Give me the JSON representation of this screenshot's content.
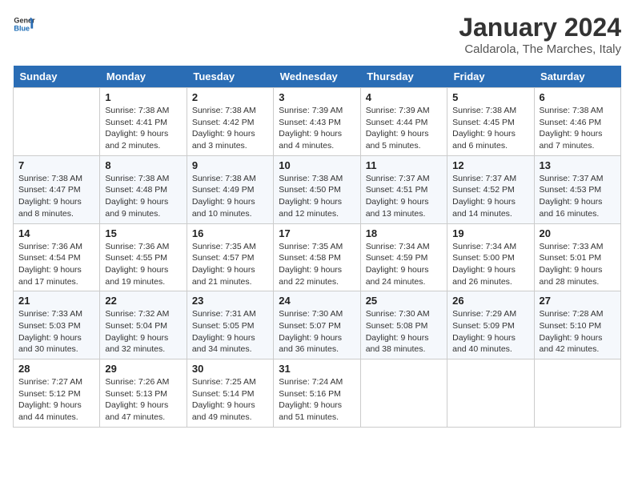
{
  "logo": {
    "text_general": "General",
    "text_blue": "Blue"
  },
  "title": "January 2024",
  "subtitle": "Caldarola, The Marches, Italy",
  "days_of_week": [
    "Sunday",
    "Monday",
    "Tuesday",
    "Wednesday",
    "Thursday",
    "Friday",
    "Saturday"
  ],
  "weeks": [
    [
      {
        "day": "",
        "sunrise": "",
        "sunset": "",
        "daylight": ""
      },
      {
        "day": "1",
        "sunrise": "Sunrise: 7:38 AM",
        "sunset": "Sunset: 4:41 PM",
        "daylight": "Daylight: 9 hours and 2 minutes."
      },
      {
        "day": "2",
        "sunrise": "Sunrise: 7:38 AM",
        "sunset": "Sunset: 4:42 PM",
        "daylight": "Daylight: 9 hours and 3 minutes."
      },
      {
        "day": "3",
        "sunrise": "Sunrise: 7:39 AM",
        "sunset": "Sunset: 4:43 PM",
        "daylight": "Daylight: 9 hours and 4 minutes."
      },
      {
        "day": "4",
        "sunrise": "Sunrise: 7:39 AM",
        "sunset": "Sunset: 4:44 PM",
        "daylight": "Daylight: 9 hours and 5 minutes."
      },
      {
        "day": "5",
        "sunrise": "Sunrise: 7:38 AM",
        "sunset": "Sunset: 4:45 PM",
        "daylight": "Daylight: 9 hours and 6 minutes."
      },
      {
        "day": "6",
        "sunrise": "Sunrise: 7:38 AM",
        "sunset": "Sunset: 4:46 PM",
        "daylight": "Daylight: 9 hours and 7 minutes."
      }
    ],
    [
      {
        "day": "7",
        "sunrise": "Sunrise: 7:38 AM",
        "sunset": "Sunset: 4:47 PM",
        "daylight": "Daylight: 9 hours and 8 minutes."
      },
      {
        "day": "8",
        "sunrise": "Sunrise: 7:38 AM",
        "sunset": "Sunset: 4:48 PM",
        "daylight": "Daylight: 9 hours and 9 minutes."
      },
      {
        "day": "9",
        "sunrise": "Sunrise: 7:38 AM",
        "sunset": "Sunset: 4:49 PM",
        "daylight": "Daylight: 9 hours and 10 minutes."
      },
      {
        "day": "10",
        "sunrise": "Sunrise: 7:38 AM",
        "sunset": "Sunset: 4:50 PM",
        "daylight": "Daylight: 9 hours and 12 minutes."
      },
      {
        "day": "11",
        "sunrise": "Sunrise: 7:37 AM",
        "sunset": "Sunset: 4:51 PM",
        "daylight": "Daylight: 9 hours and 13 minutes."
      },
      {
        "day": "12",
        "sunrise": "Sunrise: 7:37 AM",
        "sunset": "Sunset: 4:52 PM",
        "daylight": "Daylight: 9 hours and 14 minutes."
      },
      {
        "day": "13",
        "sunrise": "Sunrise: 7:37 AM",
        "sunset": "Sunset: 4:53 PM",
        "daylight": "Daylight: 9 hours and 16 minutes."
      }
    ],
    [
      {
        "day": "14",
        "sunrise": "Sunrise: 7:36 AM",
        "sunset": "Sunset: 4:54 PM",
        "daylight": "Daylight: 9 hours and 17 minutes."
      },
      {
        "day": "15",
        "sunrise": "Sunrise: 7:36 AM",
        "sunset": "Sunset: 4:55 PM",
        "daylight": "Daylight: 9 hours and 19 minutes."
      },
      {
        "day": "16",
        "sunrise": "Sunrise: 7:35 AM",
        "sunset": "Sunset: 4:57 PM",
        "daylight": "Daylight: 9 hours and 21 minutes."
      },
      {
        "day": "17",
        "sunrise": "Sunrise: 7:35 AM",
        "sunset": "Sunset: 4:58 PM",
        "daylight": "Daylight: 9 hours and 22 minutes."
      },
      {
        "day": "18",
        "sunrise": "Sunrise: 7:34 AM",
        "sunset": "Sunset: 4:59 PM",
        "daylight": "Daylight: 9 hours and 24 minutes."
      },
      {
        "day": "19",
        "sunrise": "Sunrise: 7:34 AM",
        "sunset": "Sunset: 5:00 PM",
        "daylight": "Daylight: 9 hours and 26 minutes."
      },
      {
        "day": "20",
        "sunrise": "Sunrise: 7:33 AM",
        "sunset": "Sunset: 5:01 PM",
        "daylight": "Daylight: 9 hours and 28 minutes."
      }
    ],
    [
      {
        "day": "21",
        "sunrise": "Sunrise: 7:33 AM",
        "sunset": "Sunset: 5:03 PM",
        "daylight": "Daylight: 9 hours and 30 minutes."
      },
      {
        "day": "22",
        "sunrise": "Sunrise: 7:32 AM",
        "sunset": "Sunset: 5:04 PM",
        "daylight": "Daylight: 9 hours and 32 minutes."
      },
      {
        "day": "23",
        "sunrise": "Sunrise: 7:31 AM",
        "sunset": "Sunset: 5:05 PM",
        "daylight": "Daylight: 9 hours and 34 minutes."
      },
      {
        "day": "24",
        "sunrise": "Sunrise: 7:30 AM",
        "sunset": "Sunset: 5:07 PM",
        "daylight": "Daylight: 9 hours and 36 minutes."
      },
      {
        "day": "25",
        "sunrise": "Sunrise: 7:30 AM",
        "sunset": "Sunset: 5:08 PM",
        "daylight": "Daylight: 9 hours and 38 minutes."
      },
      {
        "day": "26",
        "sunrise": "Sunrise: 7:29 AM",
        "sunset": "Sunset: 5:09 PM",
        "daylight": "Daylight: 9 hours and 40 minutes."
      },
      {
        "day": "27",
        "sunrise": "Sunrise: 7:28 AM",
        "sunset": "Sunset: 5:10 PM",
        "daylight": "Daylight: 9 hours and 42 minutes."
      }
    ],
    [
      {
        "day": "28",
        "sunrise": "Sunrise: 7:27 AM",
        "sunset": "Sunset: 5:12 PM",
        "daylight": "Daylight: 9 hours and 44 minutes."
      },
      {
        "day": "29",
        "sunrise": "Sunrise: 7:26 AM",
        "sunset": "Sunset: 5:13 PM",
        "daylight": "Daylight: 9 hours and 47 minutes."
      },
      {
        "day": "30",
        "sunrise": "Sunrise: 7:25 AM",
        "sunset": "Sunset: 5:14 PM",
        "daylight": "Daylight: 9 hours and 49 minutes."
      },
      {
        "day": "31",
        "sunrise": "Sunrise: 7:24 AM",
        "sunset": "Sunset: 5:16 PM",
        "daylight": "Daylight: 9 hours and 51 minutes."
      },
      {
        "day": "",
        "sunrise": "",
        "sunset": "",
        "daylight": ""
      },
      {
        "day": "",
        "sunrise": "",
        "sunset": "",
        "daylight": ""
      },
      {
        "day": "",
        "sunrise": "",
        "sunset": "",
        "daylight": ""
      }
    ]
  ]
}
